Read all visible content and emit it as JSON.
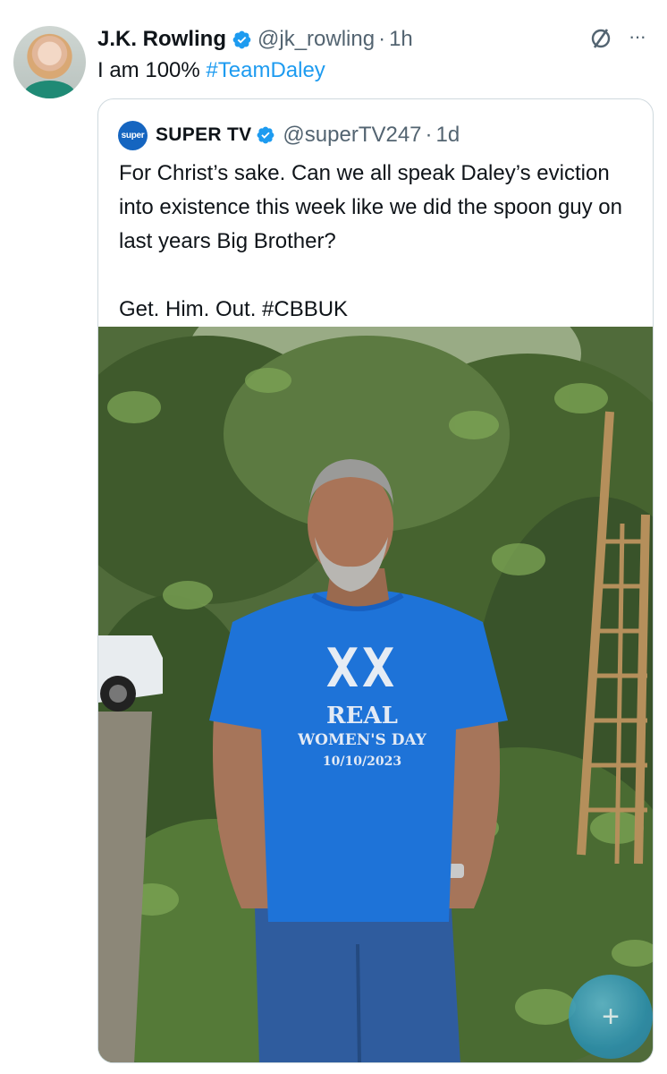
{
  "tweet": {
    "author_name": "J.K. Rowling",
    "handle": "@jk_rowling",
    "separator": "·",
    "time": "1h",
    "text_prefix": "I am 100% ",
    "hashtag": "#TeamDaley",
    "more_label": "···"
  },
  "quote": {
    "avatar_label": "super",
    "author_name": "SUPER TV",
    "handle": "@superTV247",
    "separator": "·",
    "time": "1d",
    "text": "For Christ’s sake. Can we all speak Daley’s eviction into existence this week like we did the spoon guy on last years Big Brother?\n\nGet. Him. Out. #CBBUK"
  },
  "photo": {
    "shirt_big": "XX",
    "shirt_line1": "REAL",
    "shirt_line2": "WOMEN'S DAY",
    "shirt_line3": "10/10/2023"
  },
  "fab": {
    "label": "+"
  },
  "colors": {
    "accent": "#1d9bf0",
    "shirt": "#1e73d8",
    "muted": "#536471"
  },
  "icons": [
    "verified-badge-icon",
    "grok-icon",
    "more-icon",
    "compose-plus-icon"
  ]
}
